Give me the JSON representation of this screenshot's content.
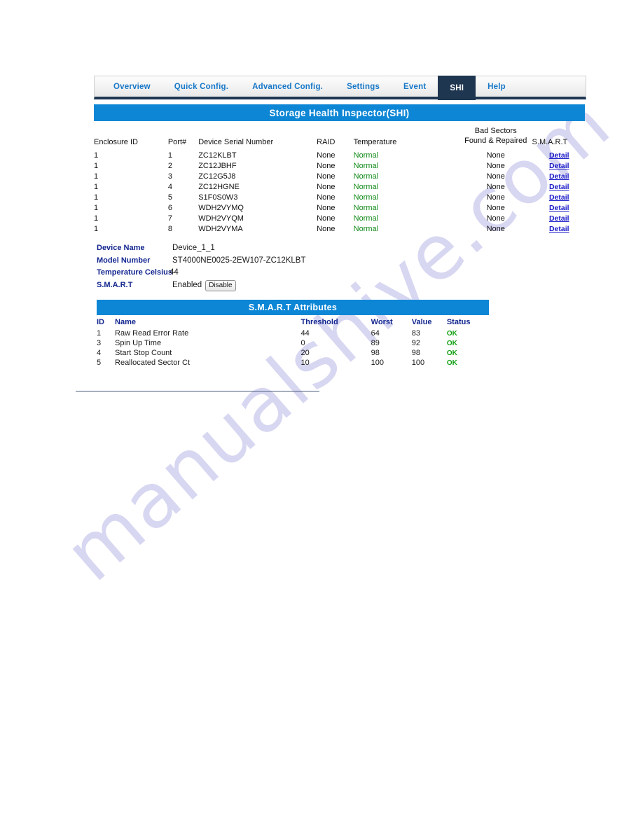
{
  "colors": {
    "accent_blue": "#0d86d5",
    "tab_active_bg": "#1e3650",
    "tab_link": "#1878c8",
    "label_navy": "#13268f",
    "status_green": "#118a18",
    "ok_green": "#12a012",
    "link_blue": "#1919c8"
  },
  "watermark": {
    "text": "manualshive.com"
  },
  "tabs": [
    {
      "label": "Overview",
      "active": false
    },
    {
      "label": "Quick Config.",
      "active": false
    },
    {
      "label": "Advanced Config.",
      "active": false
    },
    {
      "label": "Settings",
      "active": false
    },
    {
      "label": "Event",
      "active": false
    },
    {
      "label": "SHI",
      "active": true
    },
    {
      "label": "Help",
      "active": false
    }
  ],
  "shi_panel": {
    "title": "Storage Health Inspector(SHI)",
    "columns": {
      "enclosure_id": "Enclosure ID",
      "port": "Port#",
      "serial": "Device Serial Number",
      "raid": "RAID",
      "temperature": "Temperature",
      "bad_sectors_line1": "Bad Sectors",
      "bad_sectors_line2": "Found & Repaired",
      "smart": "S.M.A.R.T"
    },
    "rows": [
      {
        "enclosure_id": "1",
        "port": "1",
        "serial": "ZC12KLBT",
        "raid": "None",
        "temperature": "Normal",
        "bad_sectors": "None",
        "smart_link": "Detail"
      },
      {
        "enclosure_id": "1",
        "port": "2",
        "serial": "ZC12JBHF",
        "raid": "None",
        "temperature": "Normal",
        "bad_sectors": "None",
        "smart_link": "Detail"
      },
      {
        "enclosure_id": "1",
        "port": "3",
        "serial": "ZC12G5J8",
        "raid": "None",
        "temperature": "Normal",
        "bad_sectors": "None",
        "smart_link": "Detail"
      },
      {
        "enclosure_id": "1",
        "port": "4",
        "serial": "ZC12HGNE",
        "raid": "None",
        "temperature": "Normal",
        "bad_sectors": "None",
        "smart_link": "Detail"
      },
      {
        "enclosure_id": "1",
        "port": "5",
        "serial": "S1F0S0W3",
        "raid": "None",
        "temperature": "Normal",
        "bad_sectors": "None",
        "smart_link": "Detail"
      },
      {
        "enclosure_id": "1",
        "port": "6",
        "serial": "WDH2VYMQ",
        "raid": "None",
        "temperature": "Normal",
        "bad_sectors": "None",
        "smart_link": "Detail"
      },
      {
        "enclosure_id": "1",
        "port": "7",
        "serial": "WDH2VYQM",
        "raid": "None",
        "temperature": "Normal",
        "bad_sectors": "None",
        "smart_link": "Detail"
      },
      {
        "enclosure_id": "1",
        "port": "8",
        "serial": "WDH2VYMA",
        "raid": "None",
        "temperature": "Normal",
        "bad_sectors": "None",
        "smart_link": "Detail"
      }
    ]
  },
  "device_info": {
    "device_name_label": "Device Name",
    "device_name_value": "Device_1_1",
    "model_number_label": "Model Number",
    "model_number_value": "ST4000NE0025-2EW107-ZC12KLBT",
    "temperature_label": "Temperature Celsius",
    "temperature_value": "44",
    "smart_label": "S.M.A.R.T",
    "smart_state": "Enabled",
    "smart_button": "Disable"
  },
  "smart_attributes": {
    "title": "S.M.A.R.T Attributes",
    "columns": {
      "id": "ID",
      "name": "Name",
      "threshold": "Threshold",
      "worst": "Worst",
      "value": "Value",
      "status": "Status"
    },
    "rows": [
      {
        "id": "1",
        "name": "Raw Read Error Rate",
        "threshold": "44",
        "worst": "64",
        "value": "83",
        "status": "OK"
      },
      {
        "id": "3",
        "name": "Spin Up Time",
        "threshold": "0",
        "worst": "89",
        "value": "92",
        "status": "OK"
      },
      {
        "id": "4",
        "name": "Start Stop Count",
        "threshold": "20",
        "worst": "98",
        "value": "98",
        "status": "OK"
      },
      {
        "id": "5",
        "name": "Reallocated Sector Ct",
        "threshold": "10",
        "worst": "100",
        "value": "100",
        "status": "OK"
      }
    ]
  }
}
